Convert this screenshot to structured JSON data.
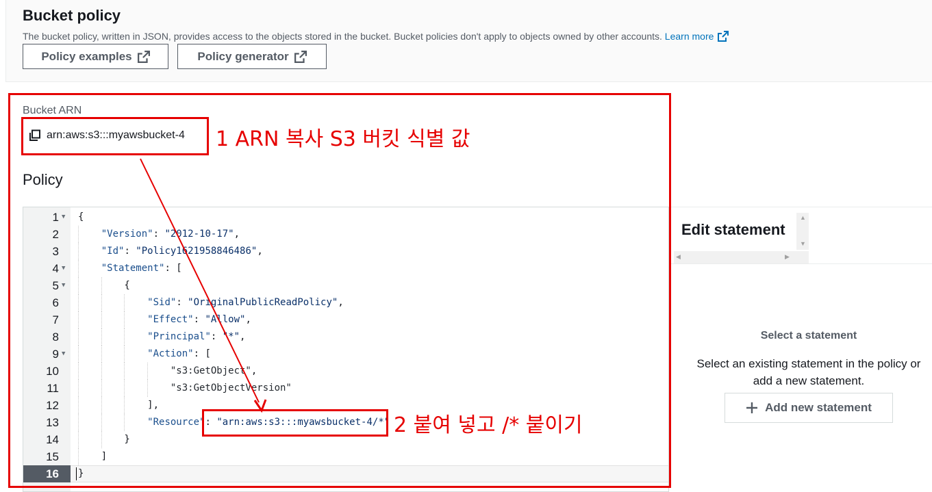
{
  "header": {
    "title": "Bucket policy",
    "description": "The bucket policy, written in JSON, provides access to the objects stored in the bucket. Bucket policies don't apply to objects owned by other accounts.",
    "learn_more": "Learn more",
    "buttons": {
      "policy_examples": "Policy examples",
      "policy_generator": "Policy generator"
    }
  },
  "bucket_arn": {
    "label": "Bucket ARN",
    "value": "arn:aws:s3:::myawsbucket-4"
  },
  "policy": {
    "heading": "Policy",
    "active_line": 16
  },
  "edit_statement": {
    "title": "Edit statement",
    "select_title": "Select a statement",
    "select_desc_line1": "Select an existing statement in the policy or",
    "select_desc_line2": "add a new statement.",
    "add_button": "Add new statement"
  },
  "annotations": {
    "note1": "1 ARN 복사 S3 버킷 식별 값",
    "note2": "2 붙여 넣고 /* 붙이기",
    "color": "#e60000"
  },
  "code_lines": [
    {
      "n": "1",
      "text": "{"
    },
    {
      "n": "2",
      "text": "    \"Version\": \"2012-10-17\","
    },
    {
      "n": "3",
      "text": "    \"Id\": \"Policy1621958846486\","
    },
    {
      "n": "4",
      "text": "    \"Statement\": ["
    },
    {
      "n": "5",
      "text": "        {"
    },
    {
      "n": "6",
      "text": "            \"Sid\": \"OriginalPublicReadPolicy\","
    },
    {
      "n": "7",
      "text": "            \"Effect\": \"Allow\","
    },
    {
      "n": "8",
      "text": "            \"Principal\": \"*\","
    },
    {
      "n": "9",
      "text": "            \"Action\": ["
    },
    {
      "n": "10",
      "text": "                \"s3:GetObject\","
    },
    {
      "n": "11",
      "text": "                \"s3:GetObjectVersion\""
    },
    {
      "n": "12",
      "text": "            ],"
    },
    {
      "n": "13",
      "text": "            \"Resource\": \"arn:aws:s3:::myawsbucket-4/*\""
    },
    {
      "n": "14",
      "text": "        }"
    },
    {
      "n": "15",
      "text": "    ]"
    },
    {
      "n": "16",
      "text": "}"
    }
  ]
}
